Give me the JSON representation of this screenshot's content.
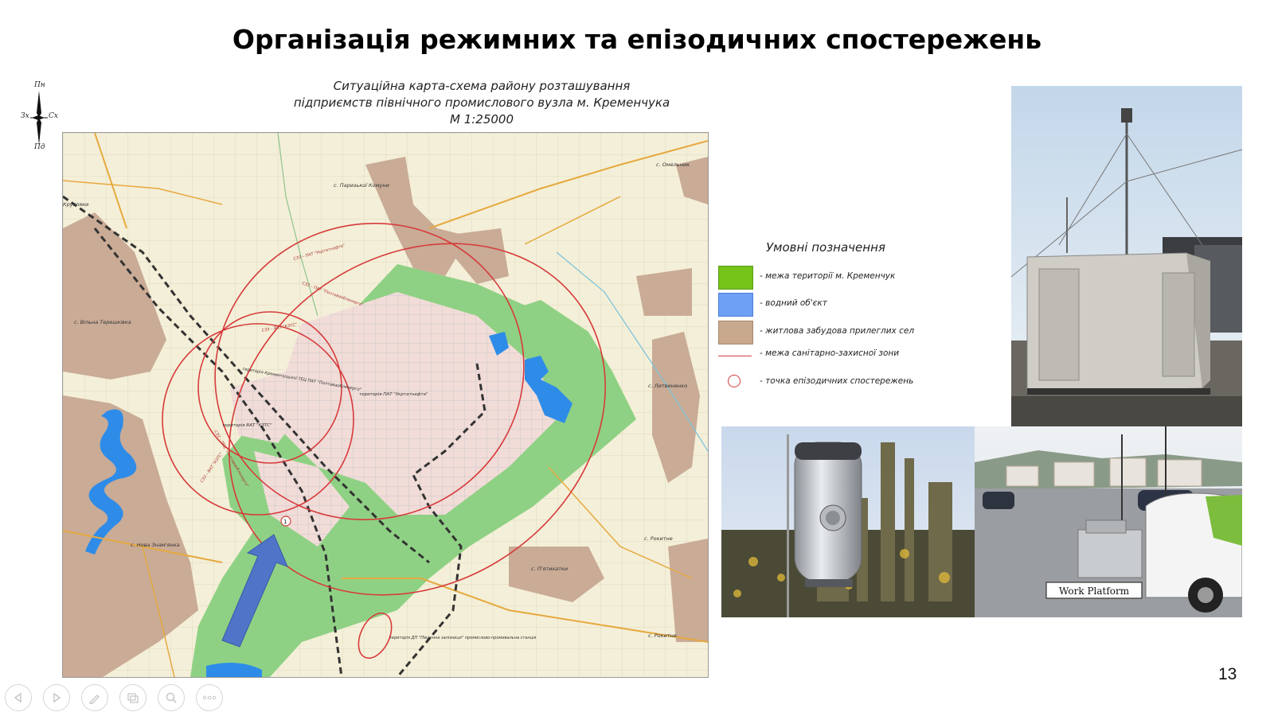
{
  "slide": {
    "title": "Організація режимних та епізодичних спостережень",
    "page_number": "13"
  },
  "compass": {
    "north": "Пн",
    "south": "Пд",
    "west": "Зх",
    "east": "Сх"
  },
  "map": {
    "caption_line1": "Ситуаційна карта-схема району розташування",
    "caption_line2": "підприємств північного промислового вузла м. Кременчука",
    "scale": "М 1:25000",
    "place_labels": {
      "omelnyk": "с. Омельник",
      "paryzkoi_komuny": "с. Паризької Комуни",
      "vilna_tereshkivka": "с. Вільна Терешківка",
      "lyvdynenko": "с. Литвиненко",
      "nova_znamianka": "с. Нова Знам'янка",
      "rokytne1": "с. Рокитне",
      "piatykhatky": "с. П'ятихатки",
      "rokytne2": "с. Рокитне",
      "kruzhyne": "Кругляки"
    },
    "site_labels": {
      "tets": "територія Кременчуцької ТЕЦ ПАТ \"Полтаваобленерго\"",
      "ukrtatnafta": "територія ПАТ \"Укртатнафта\"",
      "kzts": "територія ВАТ \"КЗТС\"",
      "station": "територія ДП \"Південна залізниця\" промислово-промивальна станція"
    },
    "zone_labels": {
      "z1": "СЗЗ – ПАТ \"Укртатнафта\"",
      "z2": "СЗЗ – ПАТ \"Полтаваобленерго\"",
      "z3": "СЗЗ – ВАТ \"КЗТС\"",
      "z4": "СЗЗ – ТЕЦ \"Полтаваобленерго\"",
      "z5": "СЗЗ – ВАТ \"КЗТС\""
    },
    "observation_point": "1"
  },
  "legend": {
    "title": "Умовні позначення",
    "items": [
      {
        "label": "- межа території м. Кременчук",
        "color": "#76c31a",
        "kind": "fill"
      },
      {
        "label": "- водний об'єкт",
        "color": "#6ea0f5",
        "kind": "fill"
      },
      {
        "label": "- житлова забудова прилеглих сел",
        "color": "#c9a98d",
        "kind": "fill"
      },
      {
        "label": "- межа санітарно-захисної зони",
        "color": "#d63b3b",
        "kind": "line"
      },
      {
        "label": "- точка епізодичних спостережень",
        "color": "#d63b3b",
        "kind": "circle"
      }
    ]
  },
  "photos": {
    "platform_label": "Work Platform"
  },
  "colors": {
    "map_base": "#f4efd8",
    "green_zone": "#8fd184",
    "residential": "#c9ab96",
    "industrial": "#f1dcd8",
    "water": "#2e8ce8",
    "zone_line": "#d63b3b",
    "road_orange": "#e6a93f",
    "arrow": "#4f74c8"
  },
  "toolbar": {
    "icons": [
      "previous-icon",
      "next-icon",
      "pen-icon",
      "slides-icon",
      "zoom-icon",
      "more-icon"
    ]
  }
}
